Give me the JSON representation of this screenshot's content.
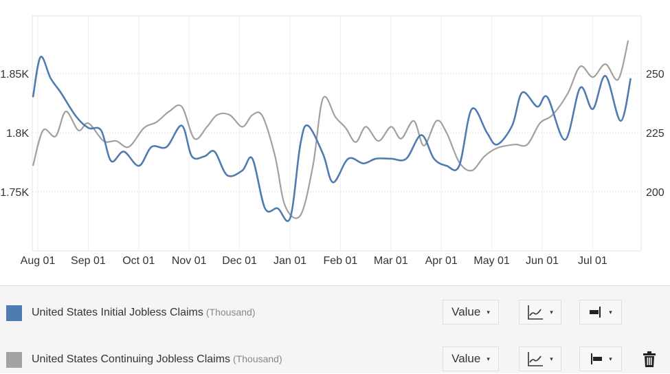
{
  "chart_data": {
    "type": "line",
    "title": "",
    "xlabel": "",
    "x_tick_labels": [
      "Aug 01",
      "Sep 01",
      "Oct 01",
      "Nov 01",
      "Dec 01",
      "Jan 01",
      "Feb 01",
      "Mar 01",
      "Apr 01",
      "May 01",
      "Jun 01",
      "Jul 01"
    ],
    "x_range_months": [
      0,
      12
    ],
    "grid": true,
    "legend_position": "bottom",
    "left_axis": {
      "ticks": [
        1750,
        1800,
        1850
      ],
      "tick_labels": [
        "1.75K",
        "1.8K",
        "1.85K"
      ],
      "ylim": [
        1700,
        1900
      ],
      "unit": "Thousand"
    },
    "right_axis": {
      "ticks": [
        200,
        225,
        250
      ],
      "tick_labels": [
        "200",
        "225",
        "250"
      ],
      "ylim": [
        175,
        275
      ],
      "unit": "Thousand"
    },
    "series": [
      {
        "name": "United States Initial Jobless Claims",
        "unit": "Thousand",
        "axis": "right",
        "color": "#4f7bb0",
        "x_months": [
          0.0,
          0.15,
          0.35,
          0.55,
          0.85,
          1.1,
          1.35,
          1.55,
          1.8,
          2.1,
          2.35,
          2.65,
          2.95,
          3.15,
          3.4,
          3.6,
          3.85,
          4.15,
          4.35,
          4.6,
          4.85,
          5.1,
          5.3,
          5.45,
          5.75,
          5.95,
          6.25,
          6.55,
          6.8,
          7.1,
          7.4,
          7.7,
          7.95,
          8.2,
          8.45,
          8.7,
          9.0,
          9.2,
          9.5,
          9.7,
          10.0,
          10.2,
          10.55,
          10.85,
          11.1,
          11.35,
          11.65,
          11.85
        ],
        "values": [
          240,
          257,
          248,
          242,
          232,
          227,
          226,
          213,
          217,
          211,
          219,
          219,
          228,
          215,
          215,
          217,
          207,
          209,
          214,
          193,
          193,
          189,
          220,
          228,
          216,
          204,
          214,
          212,
          214,
          214,
          214,
          224,
          214,
          211,
          211,
          235,
          225,
          220,
          228,
          242,
          236,
          240,
          222,
          244,
          235,
          249,
          230,
          248
        ],
        "values_note": "Estimated from chart"
      },
      {
        "name": "United States Continuing Jobless Claims",
        "unit": "Thousand",
        "axis": "left",
        "color": "#a0a0a0",
        "x_months": [
          0.0,
          0.2,
          0.45,
          0.65,
          0.9,
          1.1,
          1.4,
          1.65,
          1.9,
          2.2,
          2.45,
          2.7,
          2.95,
          3.2,
          3.45,
          3.65,
          3.9,
          4.15,
          4.35,
          4.55,
          4.8,
          5.0,
          5.3,
          5.55,
          5.75,
          6.0,
          6.2,
          6.4,
          6.6,
          6.85,
          7.1,
          7.3,
          7.55,
          7.75,
          8.0,
          8.2,
          8.45,
          8.7,
          8.95,
          9.2,
          9.55,
          9.8,
          10.05,
          10.3,
          10.6,
          10.85,
          11.1,
          11.35,
          11.6,
          11.8
        ],
        "values": [
          1772,
          1802,
          1797,
          1818,
          1802,
          1808,
          1793,
          1793,
          1788,
          1804,
          1809,
          1818,
          1822,
          1795,
          1805,
          1815,
          1815,
          1805,
          1815,
          1814,
          1780,
          1738,
          1730,
          1772,
          1829,
          1813,
          1804,
          1792,
          1805,
          1793,
          1805,
          1795,
          1810,
          1789,
          1810,
          1800,
          1775,
          1768,
          1780,
          1787,
          1790,
          1790,
          1808,
          1815,
          1833,
          1856,
          1847,
          1858,
          1845,
          1878
        ],
        "values_note": "Estimated from chart"
      }
    ]
  },
  "legend": {
    "rows": [
      {
        "label": "United States Initial Jobless Claims",
        "unit": "(Thousand)",
        "color": "#4f7bb0",
        "value_select": "Value",
        "chart_type_icon": "line-chart-icon",
        "axis_icon": "axis-right-icon",
        "has_delete": false
      },
      {
        "label": "United States Continuing Jobless Claims",
        "unit": "(Thousand)",
        "color": "#a3a3a3",
        "value_select": "Value",
        "chart_type_icon": "line-chart-icon",
        "axis_icon": "axis-left-icon",
        "has_delete": true
      }
    ],
    "caret": "▾",
    "delete_icon": "trash-icon"
  }
}
